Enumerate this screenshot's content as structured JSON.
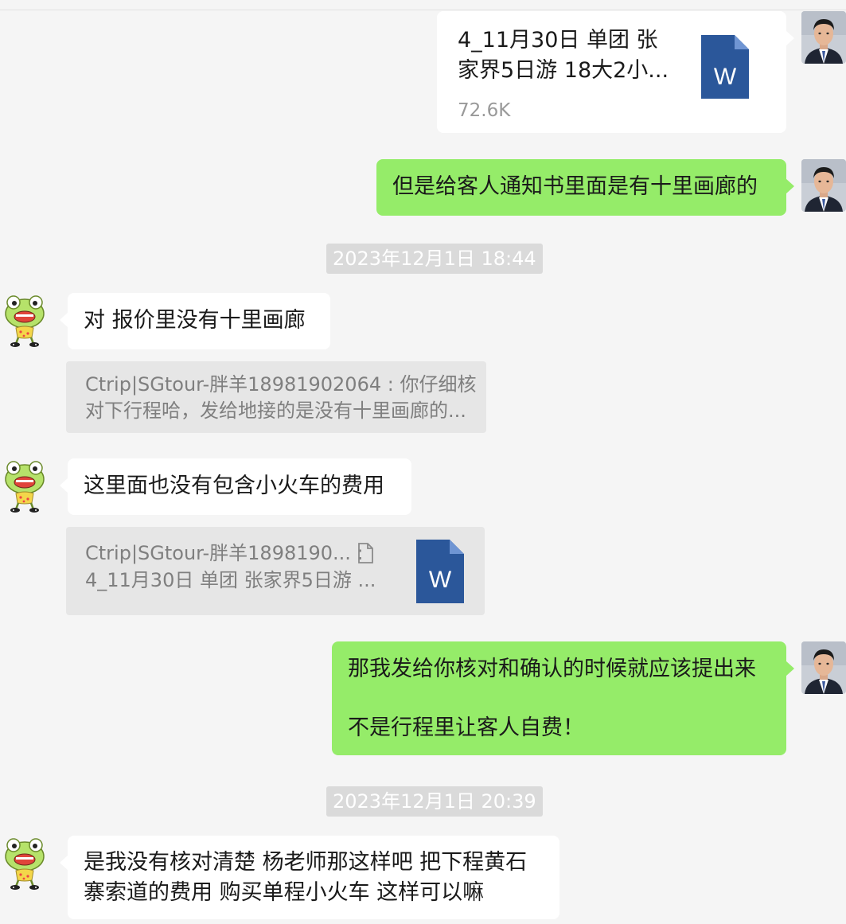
{
  "chat": {
    "file_message": {
      "name_line1": "4_11月30日 单团 张",
      "name_line2": "家界5日游  18大2小...",
      "size": "72.6K",
      "icon": "word-doc-icon",
      "icon_letter": "W"
    },
    "msg_sent_1": "但是给客人通知书里面是有十里画廊的",
    "time_1": "2023年12月1日 18:44",
    "msg_recv_1": "对 报价里没有十里画廊",
    "quote_1": {
      "line1": "Ctrip|SGtour-胖羊18981902064 : 你仔细核",
      "line2": "对下行程哈，发给地接的是没有十里画廊的..."
    },
    "msg_recv_2": "这里面也没有包含小火车的费用",
    "quote_2": {
      "line1": "Ctrip|SGtour-胖羊1898190... : ",
      "line2": "4_11月30日 单团 张家界5日游  ...",
      "icon": "word-doc-icon",
      "file_icon": "document-icon",
      "icon_letter": "W"
    },
    "msg_sent_2": {
      "line1": "那我发给你核对和确认的时候就应该提出来",
      "line2": "不是行程里让客人自费！"
    },
    "time_2": "2023年12月1日 20:39",
    "msg_recv_3": {
      "line1": "是我没有核对清楚 杨老师那这样吧 把下程黄石",
      "line2": "寨索道的费用 购买单程小火车 这样可以嘛"
    }
  },
  "colors": {
    "background": "#f5f5f5",
    "sent_bubble": "#95ec69",
    "received_bubble": "#ffffff",
    "word_blue": "#2b579a",
    "timestamp_bg": "#dadada"
  }
}
